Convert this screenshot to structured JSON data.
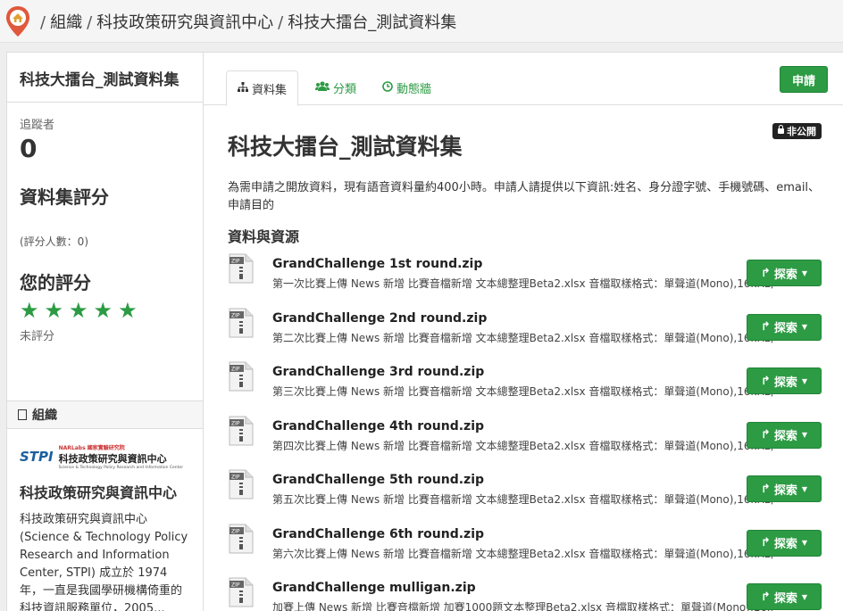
{
  "breadcrumb": {
    "home_icon": "home-pin-icon",
    "sep1": "/",
    "org": "組織",
    "sep2": "/",
    "center": "科技政策研究與資訊中心",
    "sep3": "/",
    "dataset": "科技大擂台_測試資料集"
  },
  "sidebar": {
    "title": "科技大擂台_測試資料集",
    "followers_label": "追蹤者",
    "followers_count": "0",
    "rating_title": "資料集評分",
    "rating_count": "(評分人數：0)",
    "my_rating_title": "您的評分",
    "stars": 5,
    "unrated": "未評分",
    "org_heading": "組織",
    "logo": {
      "stpi": "STPI",
      "top": "NARLabs 國家實驗研究院",
      "main": "科技政策研究與資訊中心",
      "en": "Science & Technology Policy Research and Information Center"
    },
    "org_name": "科技政策研究與資訊中心",
    "org_desc": "科技政策研究與資訊中心 (Science & Technology Policy Research and Information Center, STPI) 成立於 1974 年，一直是我國學研機構倚重的科技資訊服務單位，2005..."
  },
  "tabs": [
    {
      "label": "資料集",
      "icon": "sitemap-icon"
    },
    {
      "label": "分類",
      "icon": "users-icon"
    },
    {
      "label": "動態牆",
      "icon": "clock-icon"
    }
  ],
  "apply_label": "申請",
  "private_label": "非公開",
  "dataset": {
    "title": "科技大擂台_測試資料集",
    "description": "為需申請之開放資料，現有語音資料量約400小時。申請人請提供以下資訊:姓名、身分證字號、手機號碼、email、申請目的",
    "resources_heading": "資料與資源"
  },
  "explore_label": "探索",
  "resources": [
    {
      "name": "GrandChallenge 1st round.zip",
      "desc": "第一次比賽上傳 News 新增 比賽音檔新增 文本總整理Beta2.xlsx 音檔取樣格式：單聲道(Mono),16kHz,16 bit ..."
    },
    {
      "name": "GrandChallenge 2nd round.zip",
      "desc": "第二次比賽上傳 News 新增 比賽音檔新增 文本總整理Beta2.xlsx 音檔取樣格式：單聲道(Mono),16kHz,16 bit ..."
    },
    {
      "name": "GrandChallenge 3rd round.zip",
      "desc": "第三次比賽上傳 News 新增 比賽音檔新增 文本總整理Beta2.xlsx 音檔取樣格式：單聲道(Mono),16kHz,16 bit ..."
    },
    {
      "name": "GrandChallenge 4th round.zip",
      "desc": "第四次比賽上傳 News 新增 比賽音檔新增 文本總整理Beta2.xlsx 音檔取樣格式：單聲道(Mono),16kHz,16 bit ..."
    },
    {
      "name": "GrandChallenge 5th round.zip",
      "desc": "第五次比賽上傳 News 新增 比賽音檔新增 文本總整理Beta2.xlsx 音檔取樣格式：單聲道(Mono),16kHz,16 bit ..."
    },
    {
      "name": "GrandChallenge 6th round.zip",
      "desc": "第六次比賽上傳 News 新增 比賽音檔新增 文本總整理Beta2.xlsx 音檔取樣格式：單聲道(Mono),16kHz,16 bit ..."
    },
    {
      "name": "GrandChallenge mulligan.zip",
      "desc": "加賽上傳 News 新增 比賽音檔新增 加賽1000題文本整理Beta2.xlsx 音檔取樣格式：單聲道(Mono),16kHz,16 bit ..."
    }
  ],
  "colors": {
    "accent": "#2c9b43",
    "home_pin": "#e0583c"
  }
}
